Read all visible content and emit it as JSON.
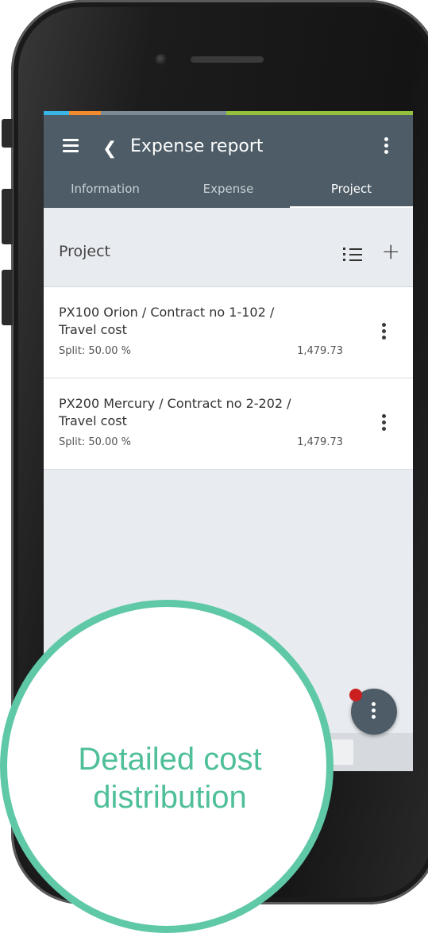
{
  "colors": {
    "header_bg": "#4d5c67",
    "accent_strip": [
      "#38b4e6",
      "#f28a2e",
      "#7a8a96",
      "#93c13d"
    ],
    "callout": "#5fc8a7",
    "notification_dot": "#cc1f1f"
  },
  "header": {
    "menu_icon": "hamburger-icon",
    "back_icon": "chevron-left-icon",
    "title": "Expense report",
    "more_icon": "kebab-icon"
  },
  "tabs": [
    {
      "label": "Information",
      "active": false
    },
    {
      "label": "Expense",
      "active": false
    },
    {
      "label": "Project",
      "active": true
    }
  ],
  "section": {
    "title": "Project",
    "list_icon": "list-icon",
    "add_icon": "plus-icon"
  },
  "items": [
    {
      "line1": "PX100 Orion / Contract no 1-102 /",
      "line2": "Travel cost",
      "split": "Split: 50.00 %",
      "amount": "1,479.73"
    },
    {
      "line1": "PX200 Mercury / Contract no 2-202 /",
      "line2": "Travel cost",
      "split": "Split: 50.00 %",
      "amount": "1,479.73"
    }
  ],
  "fab": {
    "icon": "kebab-icon",
    "has_notification": true
  },
  "callout": {
    "line1": "Detailed cost",
    "line2": "distribution"
  }
}
